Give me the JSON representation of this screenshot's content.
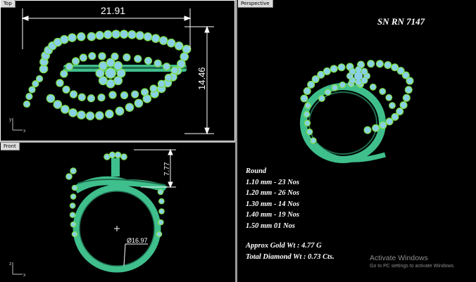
{
  "viewports": {
    "top": {
      "label": "Top"
    },
    "front": {
      "label": "Front"
    },
    "perspective": {
      "label": "Perspective"
    }
  },
  "dimensions": {
    "width": "21.91",
    "height": "14.46",
    "shank_height": "7.77",
    "diameter": "Ø16.97"
  },
  "axes": {
    "x": "x",
    "y": "y",
    "z": "z"
  },
  "product": {
    "code": "SN RN 7147"
  },
  "stones": {
    "heading": "Round",
    "lines": [
      "1.10 mm - 23 Nos",
      "1.20 mm - 26 Nos",
      "1.30 mm - 14 Nos",
      "1.40 mm - 19 Nos",
      "1.50 mm 01 Nos"
    ]
  },
  "weights": {
    "gold": "Approx Gold Wt : 4.77 G",
    "diamond": "Total Diamond Wt : 0.73 Cts."
  },
  "watermark": {
    "title": "Activate Windows",
    "subtitle": "Go to PC settings to activate Windows."
  },
  "colors": {
    "metal": "#3fbf8c",
    "metal_dark": "#1f6b4d",
    "stone": "#8ad0e6",
    "prong": "#7ee04a",
    "viewport_bg": "#000000",
    "dimension": "#ffffff"
  }
}
